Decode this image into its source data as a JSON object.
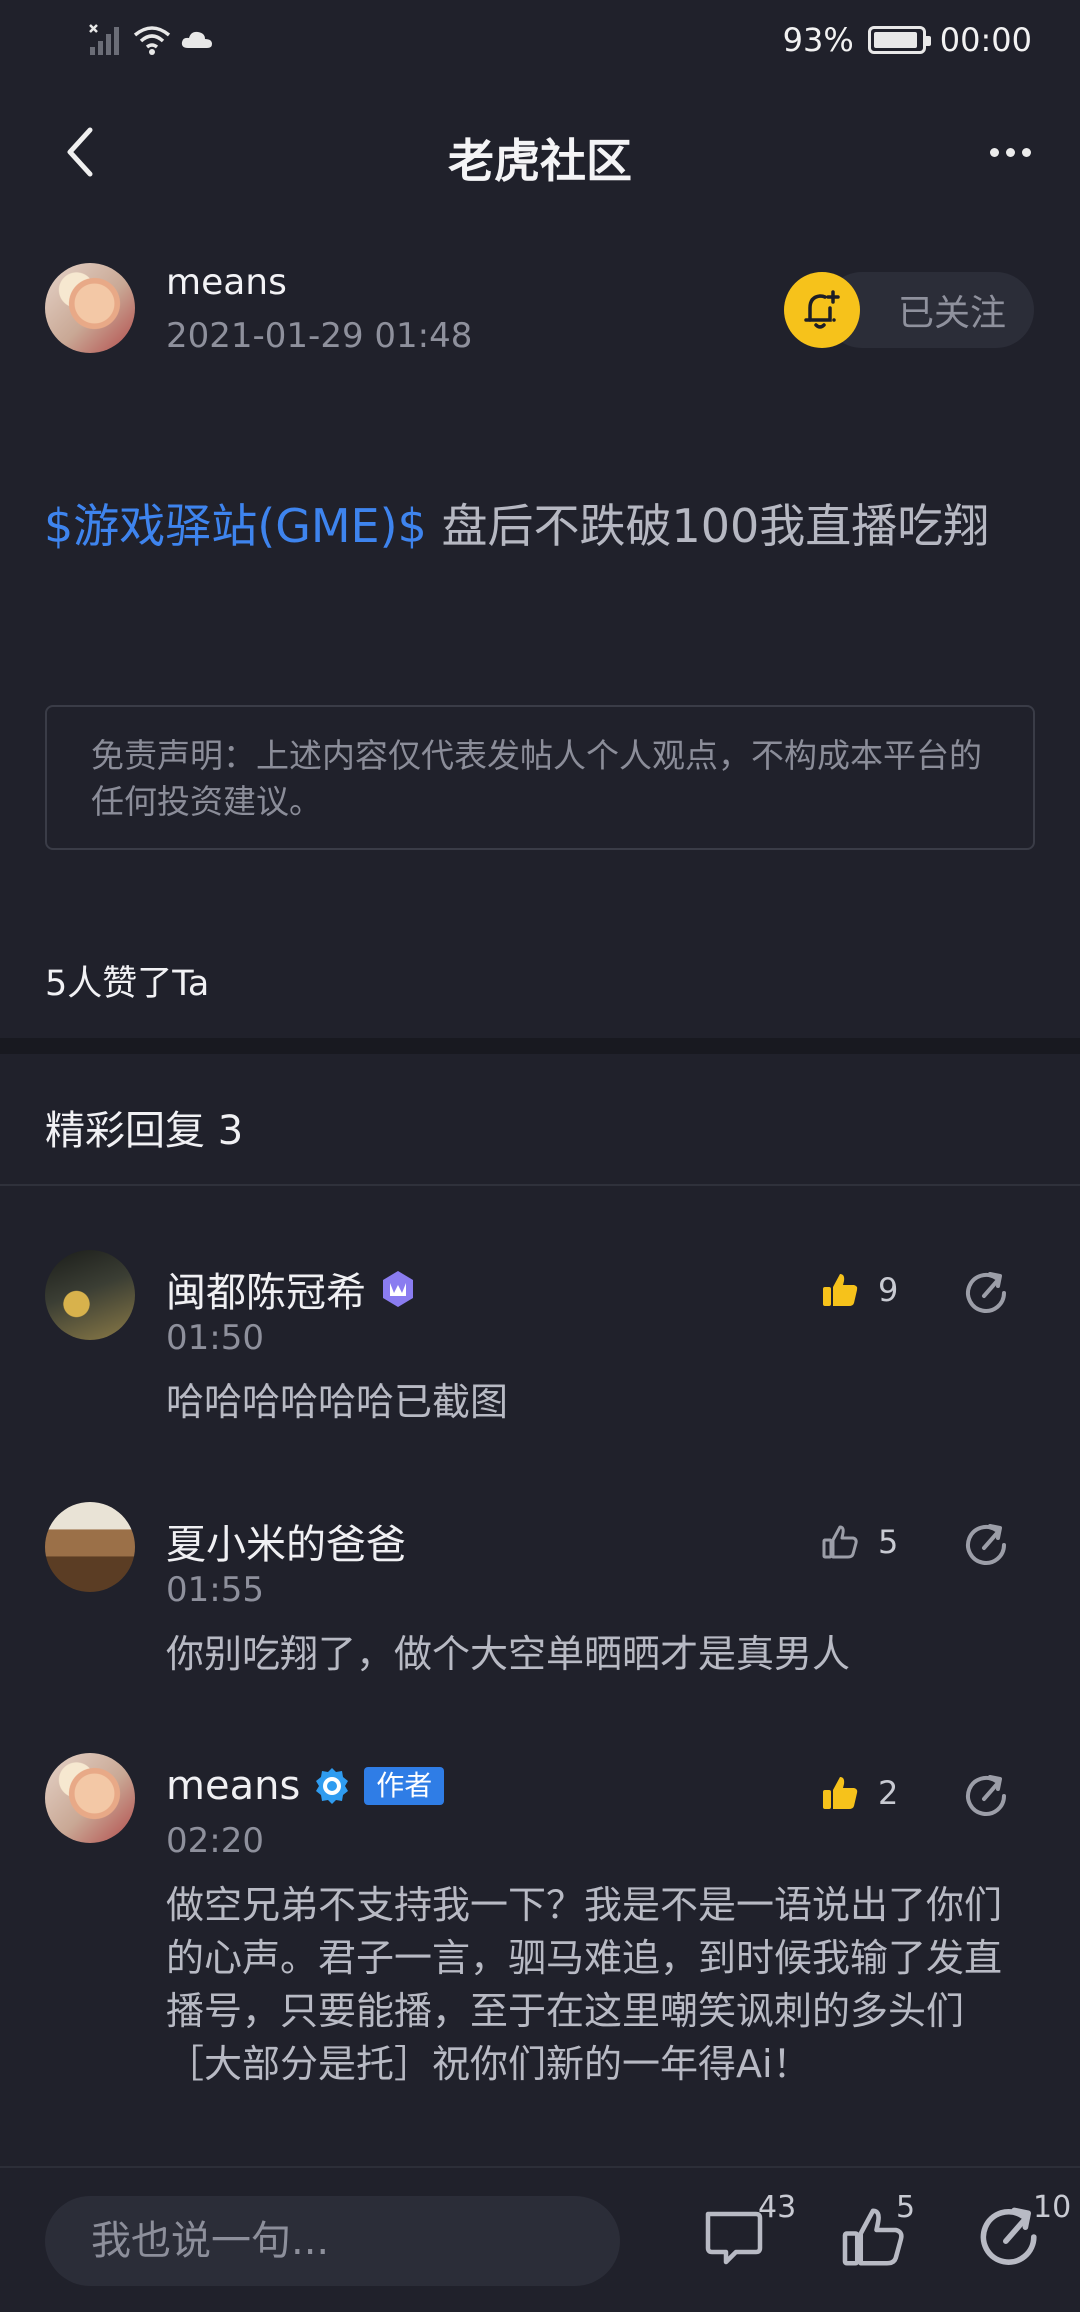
{
  "status_bar": {
    "battery_text": "93%",
    "battery_level": 0.93,
    "time": "00:00"
  },
  "header": {
    "title": "老虎社区"
  },
  "post": {
    "author": "means",
    "timestamp": "2021-01-29 01:48",
    "follow_label": "已关注",
    "stock_tag": "$游戏驿站(GME)$",
    "body_text": " 盘后不跌破100我直播吃翔",
    "disclaimer": "免责声明：上述内容仅代表发帖人个人观点，不构成本平台的任何投资建议。",
    "likes_summary": "5人赞了Ta"
  },
  "replies_title": "精彩回复 3",
  "replies": [
    {
      "name": "闽都陈冠希",
      "time": "01:50",
      "text": "哈哈哈哈哈哈已截图",
      "likes": "9",
      "liked": true,
      "badge": "vip"
    },
    {
      "name": "夏小米的爸爸",
      "time": "01:55",
      "text": "你别吃翔了，做个大空单晒晒才是真男人",
      "likes": "5",
      "liked": false,
      "badge": ""
    },
    {
      "name": "means",
      "time": "02:20",
      "text": "做空兄弟不支持我一下？我是不是一语说出了你们的心声。君子一言，驷马难追，到时候我输了发直播号，只要能播，至于在这里嘲笑讽刺的多头们［大部分是托］祝你们新的一年得Ai！",
      "likes": "2",
      "liked": true,
      "badge": "verified",
      "author_tag": "作者"
    }
  ],
  "bottom_bar": {
    "input_placeholder": "我也说一句...",
    "comment_count": "43",
    "like_count": "5",
    "share_count": "10"
  },
  "colors": {
    "accent_blue": "#3e84ee",
    "like_yellow": "#f6c21b",
    "background": "#20212b"
  }
}
